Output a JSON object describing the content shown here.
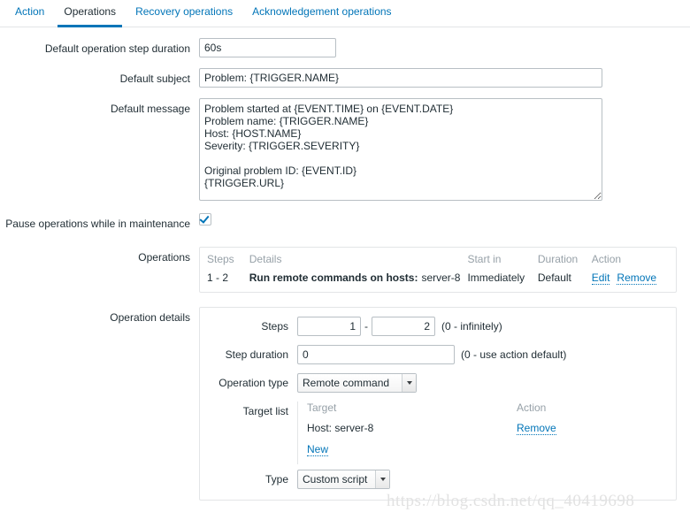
{
  "tabs": [
    {
      "label": "Action",
      "active": false
    },
    {
      "label": "Operations",
      "active": true
    },
    {
      "label": "Recovery operations",
      "active": false
    },
    {
      "label": "Acknowledgement operations",
      "active": false
    }
  ],
  "form": {
    "default_step_duration": {
      "label": "Default operation step duration",
      "value": "60s",
      "placeholder": ""
    },
    "default_subject": {
      "label": "Default subject",
      "value": "Problem: {TRIGGER.NAME}",
      "placeholder": ""
    },
    "default_message": {
      "label": "Default message",
      "value": "Problem started at {EVENT.TIME} on {EVENT.DATE}\nProblem name: {TRIGGER.NAME}\nHost: {HOST.NAME}\nSeverity: {TRIGGER.SEVERITY}\n\nOriginal problem ID: {EVENT.ID}\n{TRIGGER.URL}",
      "placeholder": ""
    },
    "pause_maintenance": {
      "label": "Pause operations while in maintenance",
      "checked": true
    },
    "operations": {
      "label": "Operations",
      "columns": [
        "Steps",
        "Details",
        "Start in",
        "Duration",
        "Action"
      ],
      "rows": [
        {
          "steps": "1 - 2",
          "details_strong": "Run remote commands on hosts:",
          "details_value": "server-8",
          "start_in": "Immediately",
          "duration": "Default",
          "actions": [
            "Edit",
            "Remove"
          ]
        }
      ]
    },
    "operation_details": {
      "label": "Operation details",
      "steps": {
        "label": "Steps",
        "from": "1",
        "to": "2",
        "separator": "-",
        "hint": "(0 - infinitely)"
      },
      "step_duration": {
        "label": "Step duration",
        "value": "0",
        "hint": "(0 - use action default)"
      },
      "operation_type": {
        "label": "Operation type",
        "selected": "Remote command"
      },
      "target_list": {
        "label": "Target list",
        "columns": [
          "Target",
          "Action"
        ],
        "rows": [
          {
            "target": "Host: server-8",
            "action": "Remove"
          }
        ],
        "new_label": "New"
      },
      "type": {
        "label": "Type",
        "selected": "Custom script"
      }
    }
  },
  "watermark": "https://blog.csdn.net/qq_40419698",
  "colors": {
    "accent": "#0275b8",
    "text": "#1f2c33",
    "muted": "#97a1a8",
    "border": "#b8bfc4",
    "panel_border": "#e3e5e7"
  }
}
